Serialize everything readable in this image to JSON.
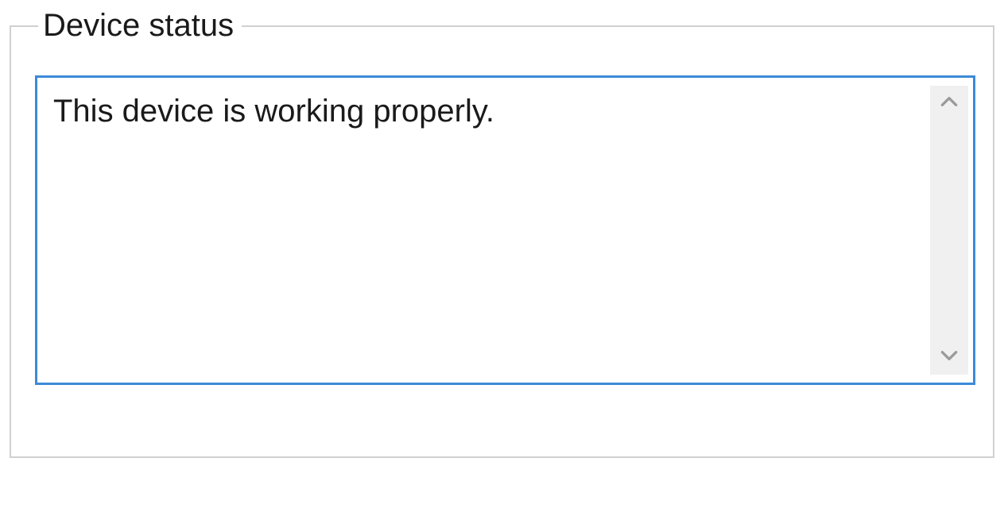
{
  "group": {
    "legend": "Device status"
  },
  "status": {
    "message": "This device is working properly."
  }
}
